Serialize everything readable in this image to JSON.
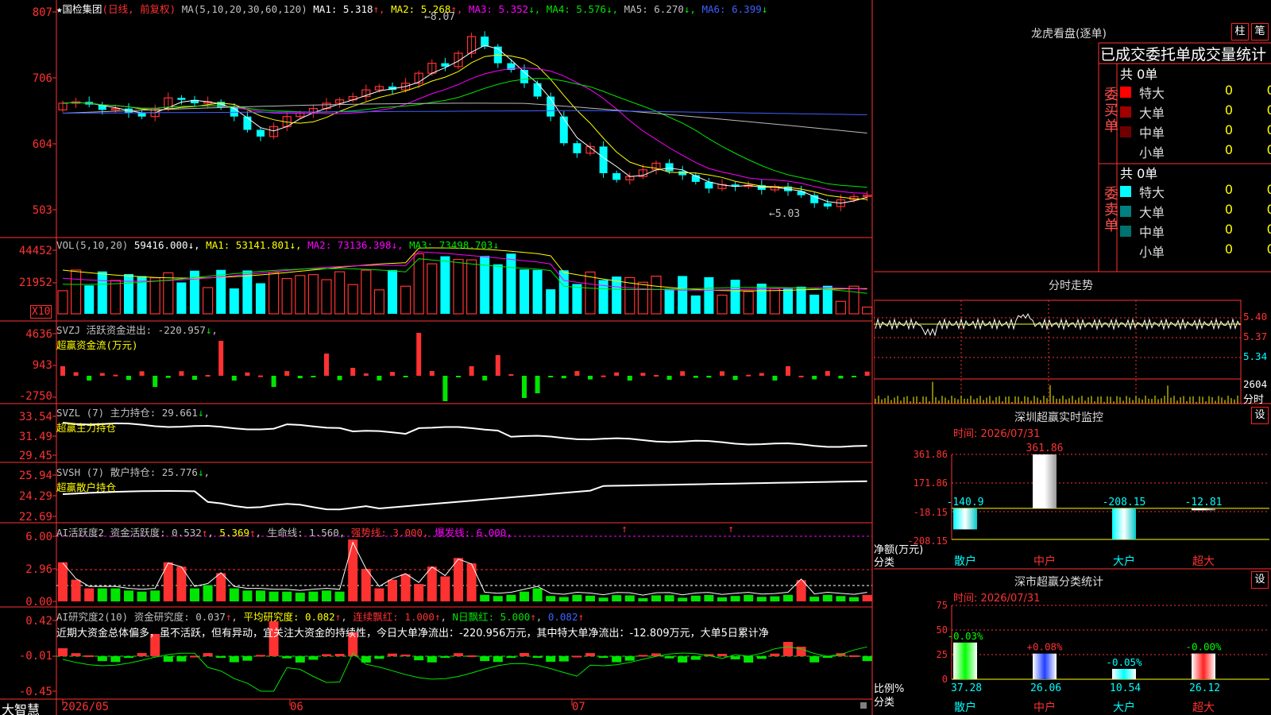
{
  "app": {
    "brand": "大智慧"
  },
  "price_panel": {
    "title_star": "★",
    "stock_name": "国检集团",
    "period": "(日线, 前复权)",
    "ma_params": "MA(5,10,20,30,60,120)",
    "ma": [
      {
        "label": "MA1: 5.318",
        "arrow": "↑",
        "color": "#ffffff"
      },
      {
        "label": "MA2: 5.268",
        "arrow": "↑",
        "color": "#ffff00"
      },
      {
        "label": "MA3: 5.352",
        "arrow": "↓",
        "color": "#ff00ff"
      },
      {
        "label": "MA4: 5.576",
        "arrow": "↓",
        "color": "#00e600"
      },
      {
        "label": "MA5: 6.270",
        "arrow": "↓",
        "color": "#c0c0c0"
      },
      {
        "label": "MA6: 6.399",
        "arrow": "↓",
        "color": "#4060ff"
      }
    ],
    "y_ticks": [
      "807",
      "706",
      "604",
      "503"
    ],
    "high_label": "8.07",
    "low_label": "5.03"
  },
  "volume_panel": {
    "title": "VOL(5,10,20)",
    "value": "59416.000",
    "ma1": "MA1: 53141.801",
    "ma2": "MA2: 73136.398",
    "ma3": "MA3: 73498.703",
    "y_ticks": [
      "44452",
      "21952"
    ],
    "unit": "X10"
  },
  "svzj_panel": {
    "title": "SVZJ  活跃资金进出: -220.957",
    "subtitle": "超赢资金流(万元)",
    "y_ticks": [
      "4636",
      "943",
      "-2750"
    ]
  },
  "svzl_panel": {
    "title": "SVZL (7) 主力持仓: 29.661",
    "subtitle": "超赢主力持仓",
    "y_ticks": [
      "33.54",
      "31.49",
      "29.45"
    ]
  },
  "svsh_panel": {
    "title": "SVSH (7) 散户持仓: 25.776",
    "subtitle": "超赢散户持仓",
    "y_ticks": [
      "25.94",
      "24.29",
      "22.69"
    ]
  },
  "ai_active_panel": {
    "title": "AI活跃度2 资金活跃度: 0.532",
    "v2": "5.369",
    "life": "生命线: 1.560,",
    "strong": "强势线: 3.000,",
    "burst": "爆发线: 6.000,",
    "y_ticks": [
      "6.00",
      "2.96",
      "0.00"
    ]
  },
  "ai_research_panel": {
    "title": "AI研究度2(10) 资金研究度: 0.037",
    "avg": "平均研究度: 0.082",
    "cont": "连续飘红: 1.000",
    "nday": "N日飘红: 5.000",
    "last": "0.082",
    "comment": "近期大资金总体偏多，虽不活跃，但有异动，宜关注大资金的持续性，今日大单净流出：-220.956万元，其中特大单净流出：-12.809万元，大单5日累计净",
    "y_ticks": [
      "0.42",
      "-0.01",
      "-0.45"
    ]
  },
  "x_axis": {
    "labels": [
      "2026/05",
      "06",
      "07"
    ]
  },
  "dragon_tiger": {
    "title": "龙虎看盘(逐单)",
    "btn_bar": "柱",
    "btn_order": "笔",
    "header": "已成交委托单成交量统计",
    "buy_label": "委买单",
    "sell_label": "委卖单",
    "buy_total": "共 0单",
    "sell_total": "共 0单",
    "buy_rows": [
      {
        "label": "特大",
        "count": "0",
        "pct": "0%",
        "color": "#ff0000"
      },
      {
        "label": "大单",
        "count": "0",
        "pct": "0%",
        "color": "#a00000"
      },
      {
        "label": "中单",
        "count": "0",
        "pct": "0%",
        "color": "#700000"
      },
      {
        "label": "小单",
        "count": "0",
        "pct": "0%",
        "color": ""
      }
    ],
    "sell_rows": [
      {
        "label": "特大",
        "count": "0",
        "pct": "0%",
        "color": "#00ffff"
      },
      {
        "label": "大单",
        "count": "0",
        "pct": "0%",
        "color": "#008080"
      },
      {
        "label": "中单",
        "count": "0",
        "pct": "0%",
        "color": "#007070"
      },
      {
        "label": "小单",
        "count": "0",
        "pct": "0%",
        "color": ""
      }
    ]
  },
  "intraday": {
    "title": "分时走势",
    "y_ticks": [
      "5.40",
      "5.37",
      "5.34"
    ],
    "vol_label": "2604",
    "footer": "分时"
  },
  "shenzhen_monitor": {
    "title": "深圳超赢实时监控",
    "btn": "设",
    "time": "时间: 2026/07/31",
    "y_ticks": [
      "361.86",
      "171.86",
      "-18.15",
      "-208.15"
    ],
    "y_label_1": "净额(万元)",
    "y_label_2": "分类",
    "chart_data": {
      "type": "bar",
      "categories": [
        "散户",
        "中户",
        "大户",
        "超大"
      ],
      "values": [
        -140.9,
        361.86,
        -208.15,
        -12.81
      ],
      "labels": [
        "-140.9",
        "361.86",
        "-208.15",
        "-12.81"
      ],
      "ylim": [
        -208.15,
        361.86
      ]
    }
  },
  "shenzhen_class": {
    "title": "深市超赢分类统计",
    "btn": "设",
    "time": "时间: 2026/07/31",
    "y_ticks": [
      "75",
      "50",
      "25",
      "0"
    ],
    "y_label_1": "比例%",
    "y_label_2": "分类",
    "chart_data": {
      "type": "bar",
      "categories": [
        "散户",
        "中户",
        "大户",
        "超大"
      ],
      "values": [
        37.28,
        26.06,
        10.54,
        26.12
      ],
      "change_labels": [
        "-0.03%",
        "+0.08%",
        "-0.05%",
        "-0.00%"
      ],
      "value_labels": [
        "37.28",
        "26.06",
        "10.54",
        "26.12"
      ],
      "ylim": [
        0,
        75
      ]
    }
  }
}
